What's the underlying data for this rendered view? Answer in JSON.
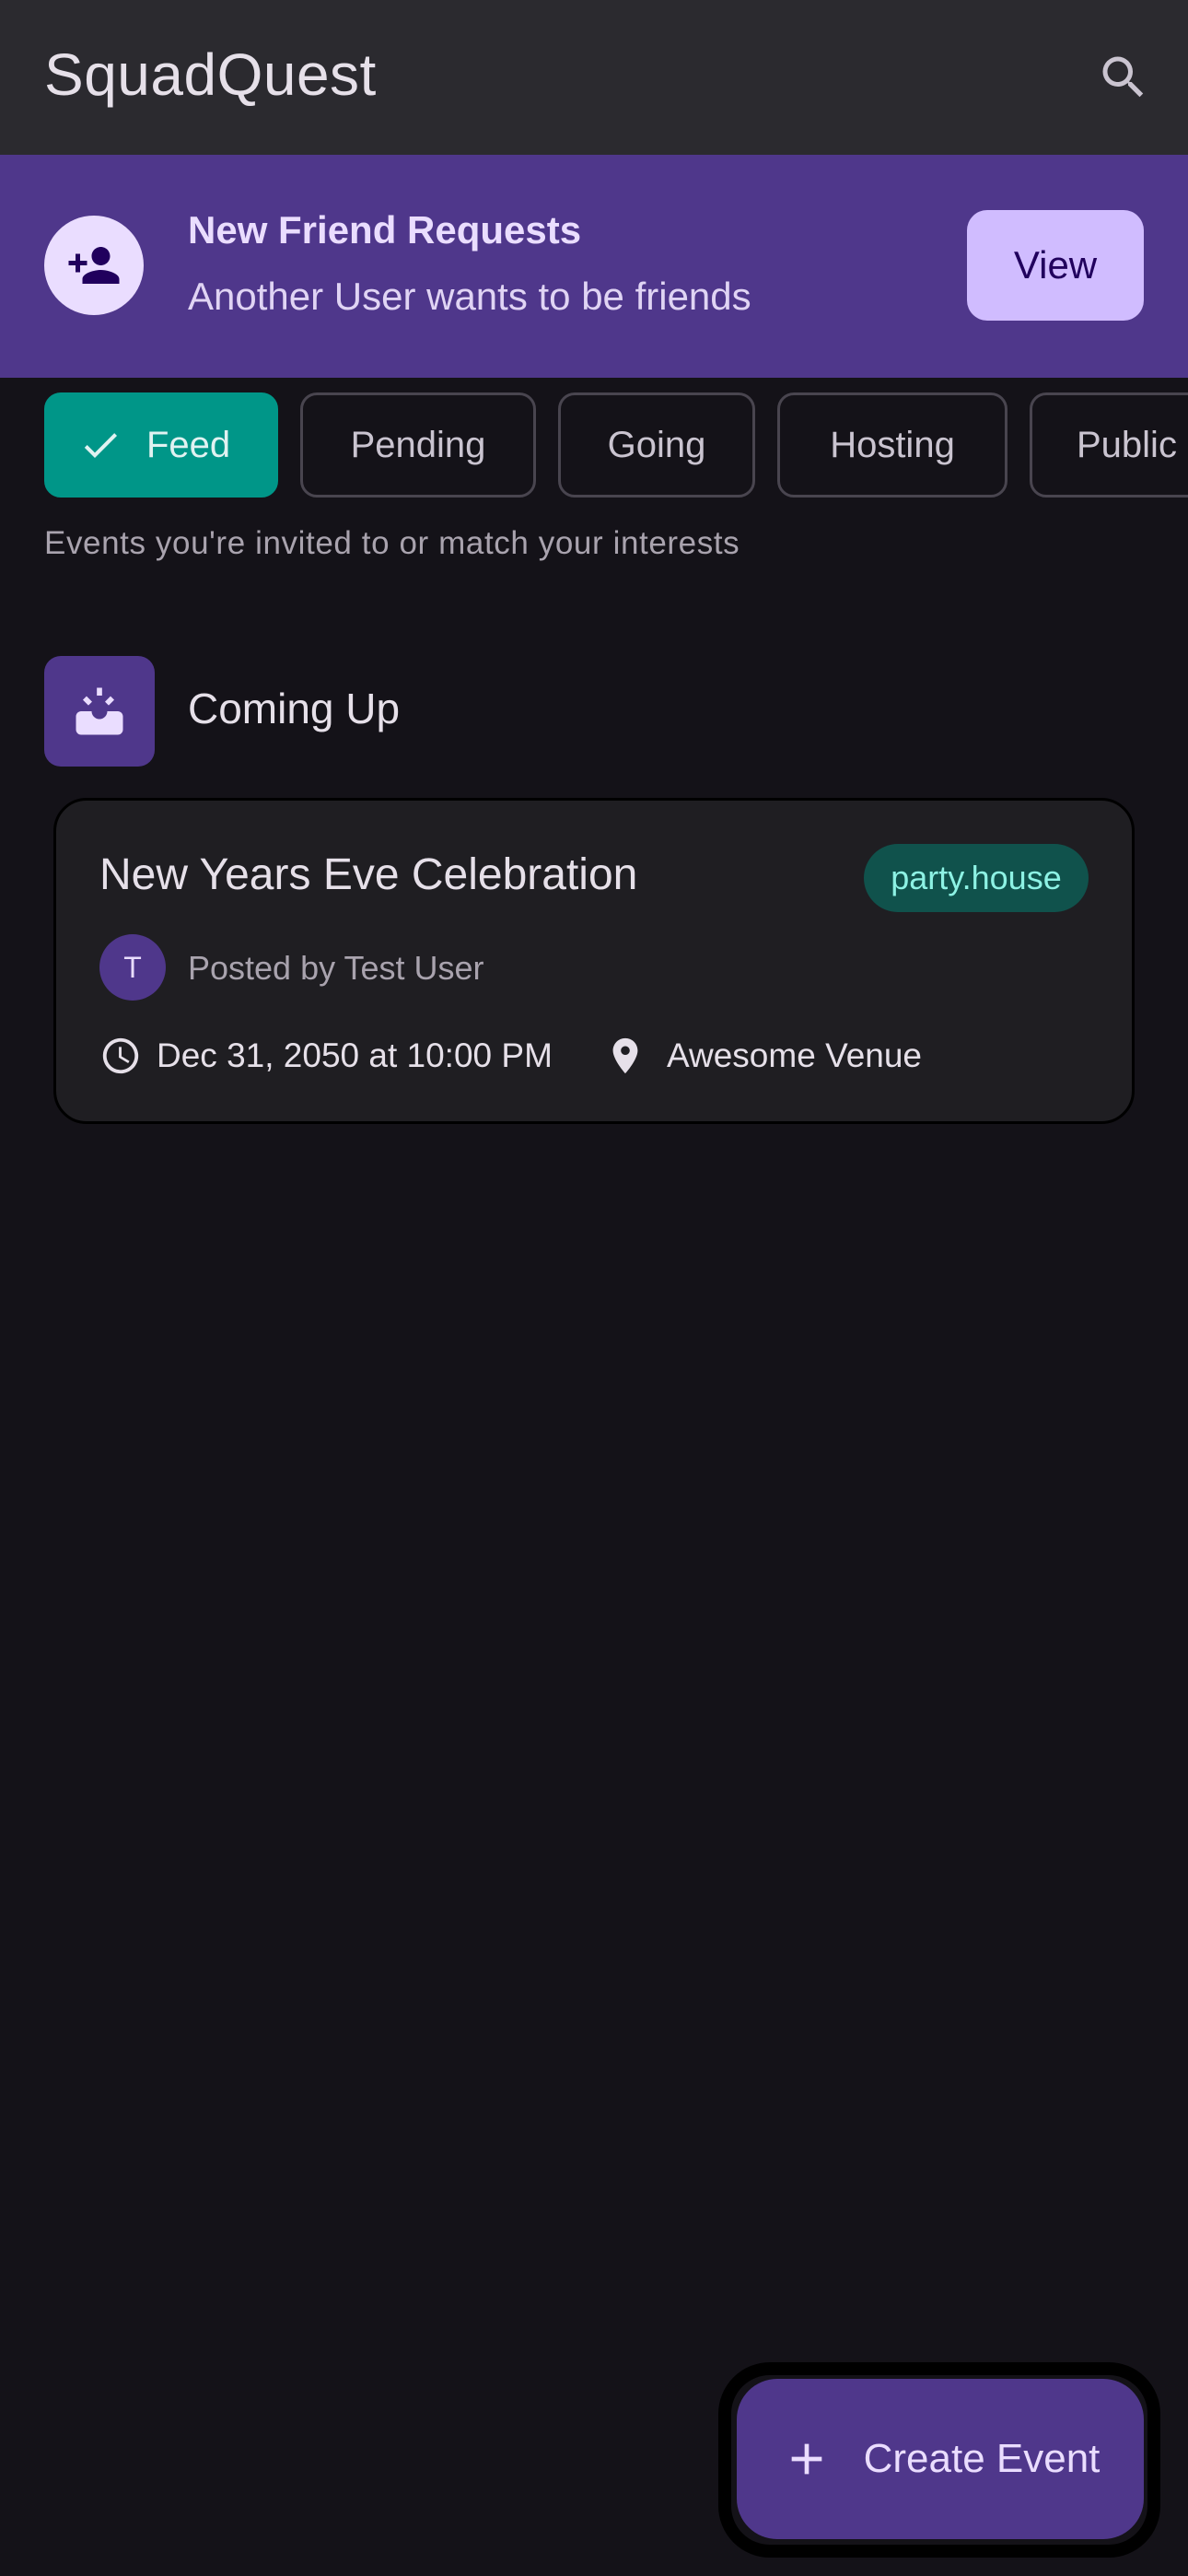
{
  "app": {
    "title": "SquadQuest"
  },
  "banner": {
    "title": "New Friend Requests",
    "subtitle": "Another User wants to be friends",
    "action_label": "View"
  },
  "filters": {
    "selected": "Feed",
    "chips": [
      "Feed",
      "Pending",
      "Going",
      "Hosting",
      "Public"
    ],
    "hint": "Events you're invited to or match your interests"
  },
  "section": {
    "title": "Coming Up"
  },
  "events": [
    {
      "title": "New Years Eve Celebration",
      "tag": "party.house",
      "poster_initial": "T",
      "poster_text": "Posted by Test User",
      "datetime": "Dec 31, 2050 at 10:00 PM",
      "venue": "Awesome Venue"
    }
  ],
  "fab": {
    "label": "Create Event"
  },
  "colors": {
    "background": "#141218",
    "appbar": "#2b2a2f",
    "primary_container": "#4f378b",
    "selected_chip": "#009688",
    "tag_bg": "#10524c"
  },
  "icons": [
    "search-icon",
    "person-add-icon",
    "check-icon",
    "upcoming-icon",
    "clock-icon",
    "location-pin-icon",
    "plus-icon"
  ]
}
